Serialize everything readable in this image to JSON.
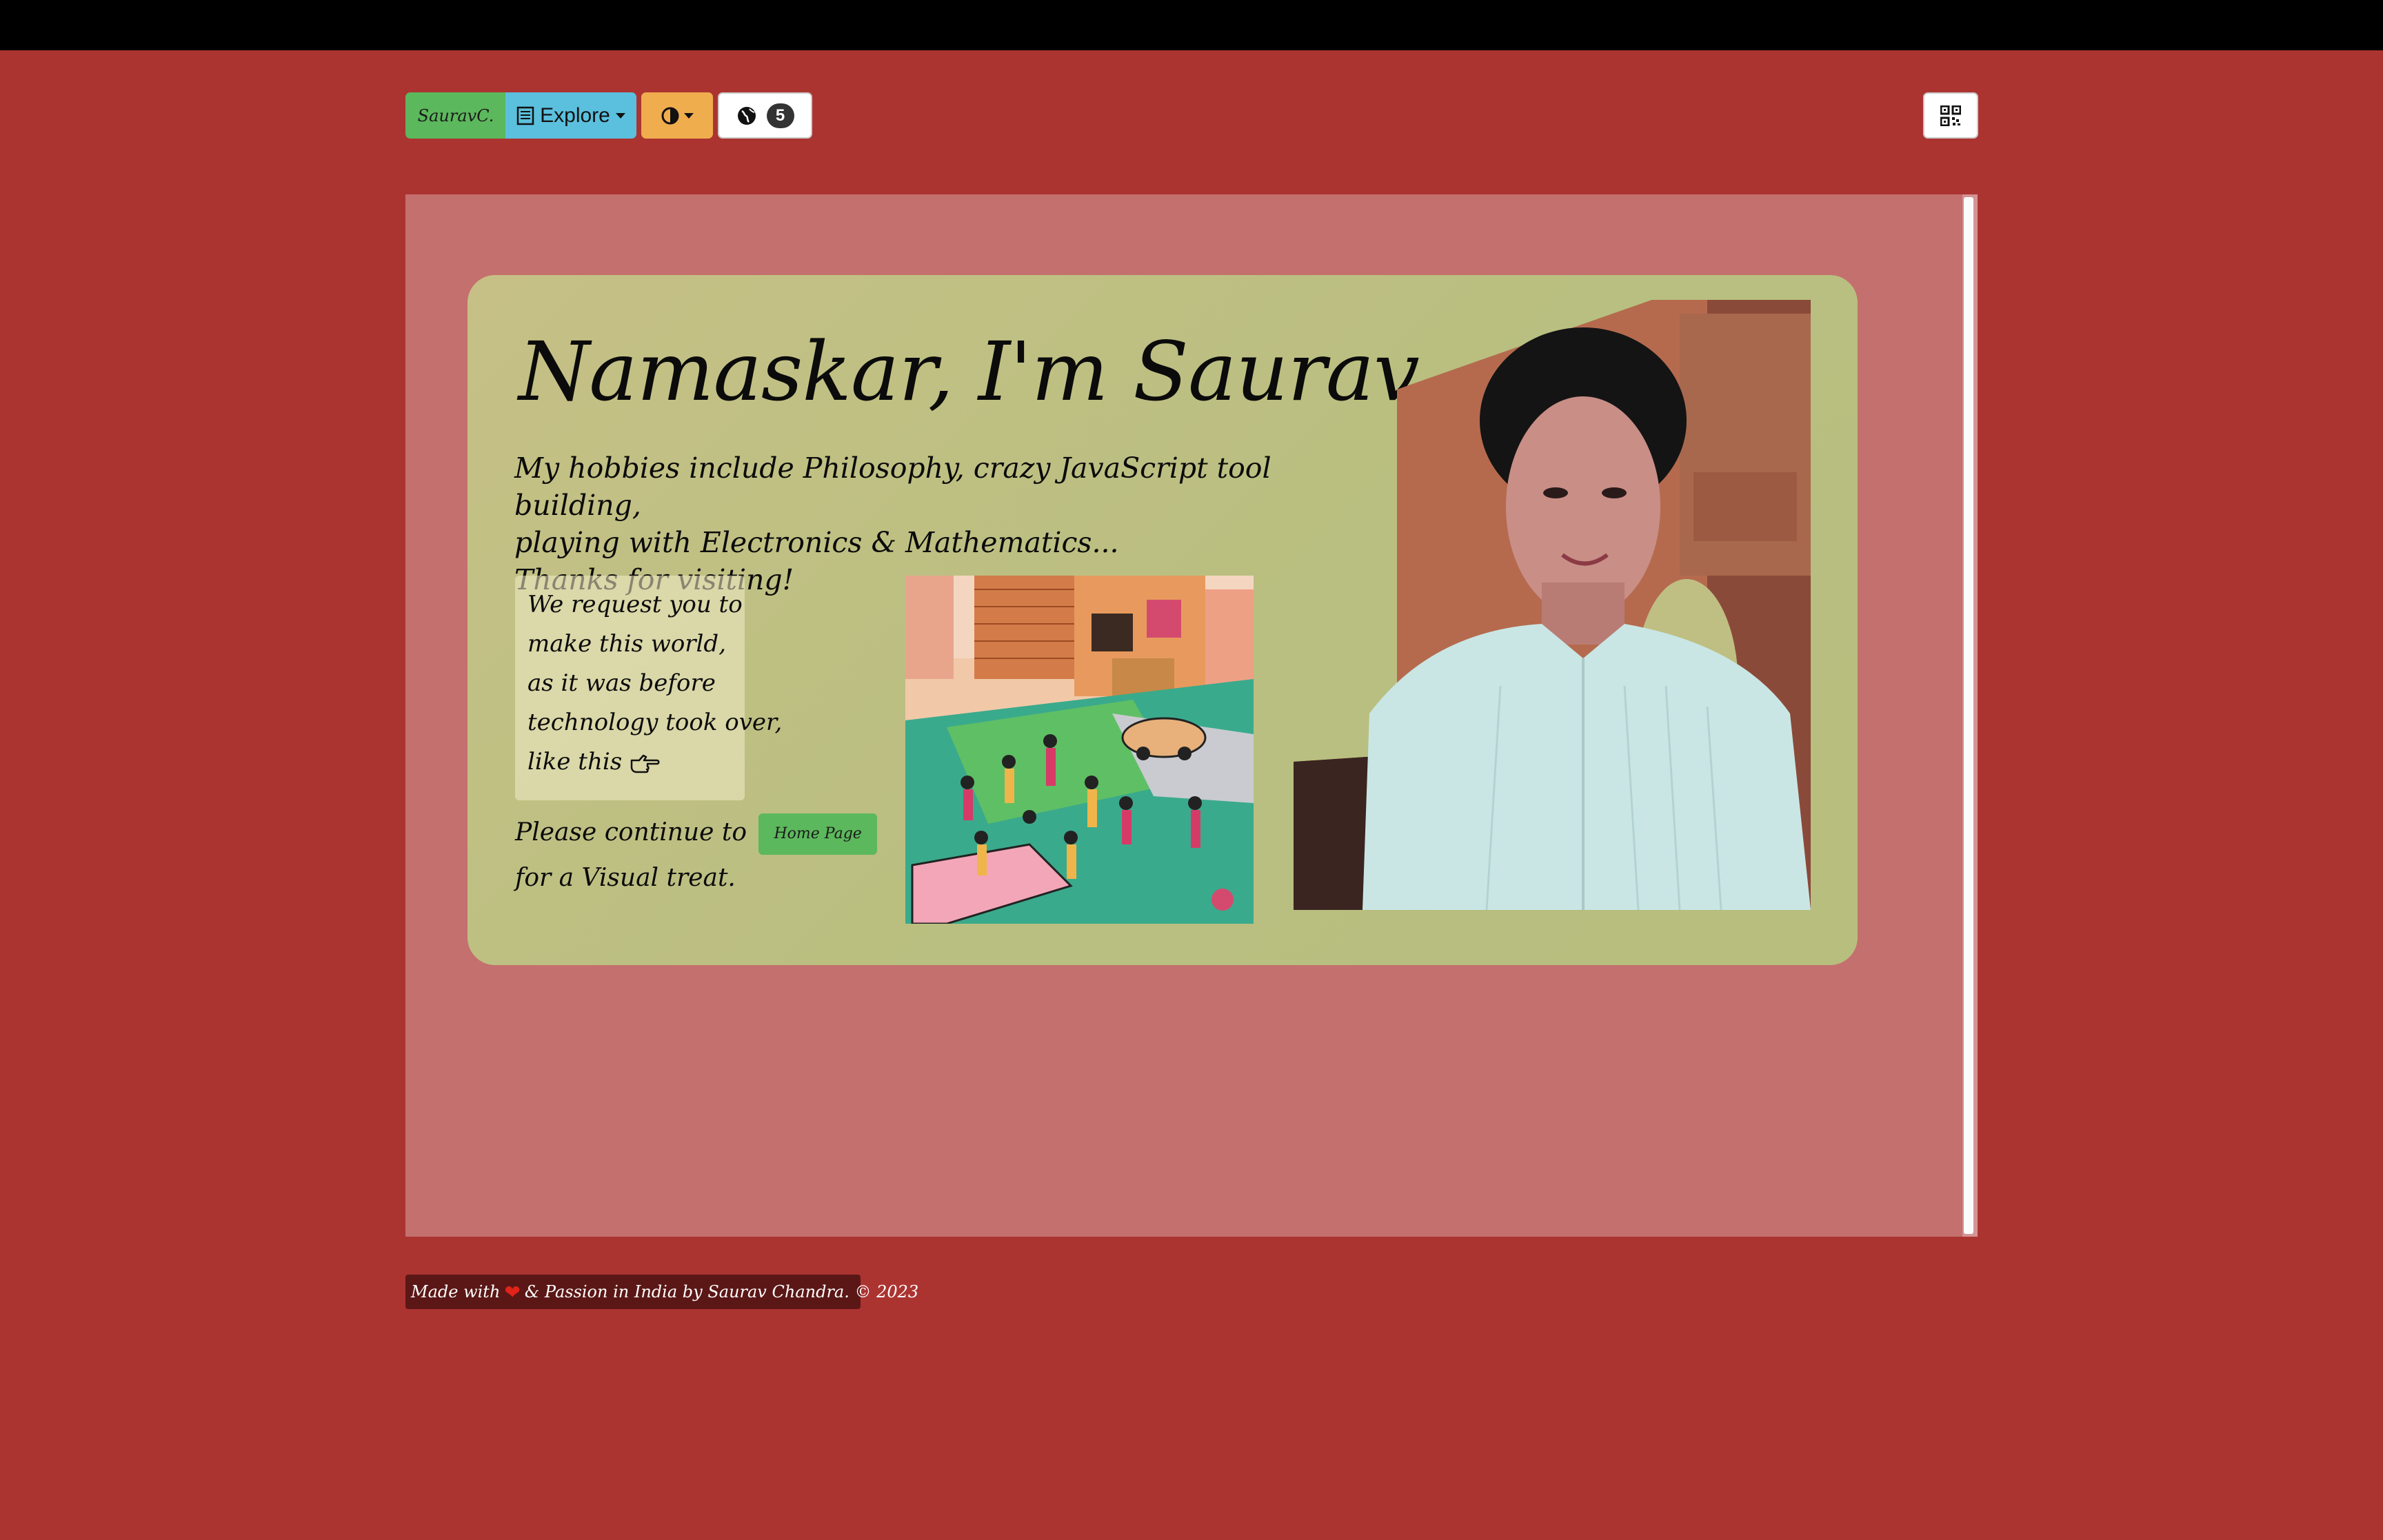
{
  "nav": {
    "brand": "SauravC.",
    "explore_label": "Explore",
    "globe_count": "5"
  },
  "hero": {
    "title": "Namaskar, I'm Saurav",
    "hobbies_line1": "My hobbies include Philosophy, crazy JavaScript tool building,",
    "hobbies_line2": "playing with Electronics & Mathematics...",
    "hobbies_line3": "Thanks for visiting!",
    "quote_lines": [
      "We request you to",
      "make this world,",
      "as it was before",
      "technology took over,",
      "like this"
    ],
    "continue_prefix": "Please continue to",
    "home_button": "Home Page",
    "continue_suffix": "for a Visual treat."
  },
  "footer": {
    "made_with": "Made with",
    "rest": "& Passion in India by Saurav Chandra. © 2023"
  },
  "colors": {
    "page_bg": "#ab3431",
    "panel_bg": "#c4706e",
    "card_bg": "#bfbf83",
    "brand_btn": "#5cb85c",
    "explore_btn": "#5bc0de",
    "theme_btn": "#f0ad4e",
    "footer_bg": "#5a1716"
  },
  "icons": [
    "book-icon",
    "contrast-icon",
    "globe-icon",
    "qr-code-icon",
    "hand-pointing-right-icon",
    "heart-icon"
  ]
}
